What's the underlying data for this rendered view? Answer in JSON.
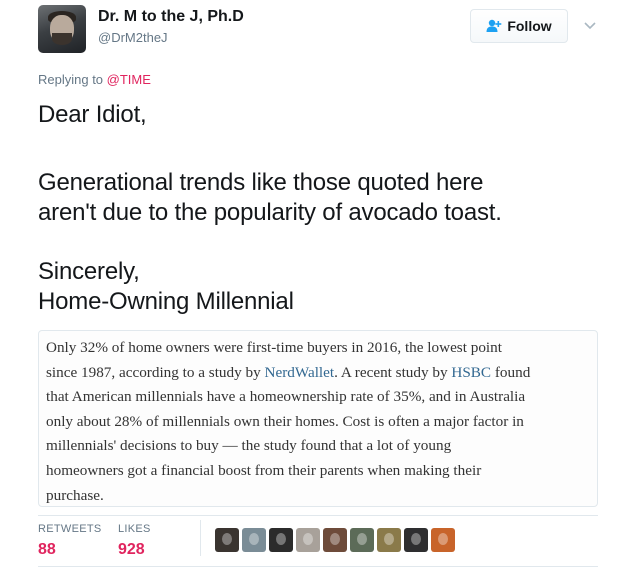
{
  "author": {
    "name": "Dr. M to the J, Ph.D",
    "handle": "@DrM2theJ",
    "avatar_icon": "user-avatar"
  },
  "follow_button": {
    "label": "Follow",
    "icon": "add-user-icon"
  },
  "menu": {
    "icon": "chevron-down-icon"
  },
  "reply": {
    "prefix": "Replying to ",
    "target": "@TIME",
    "target_color": "#e0245e"
  },
  "tweet": {
    "lines": [
      "Dear Idiot,",
      "Generational trends like those quoted here",
      "aren't due to the popularity of avocado toast.",
      "Sincerely,",
      "Home-Owning Millennial"
    ]
  },
  "quote": {
    "line1": "Only 32% of home owners were first-time buyers in 2016, the lowest point",
    "line2_a": "since 1987, according to a study by ",
    "line2_link": "NerdWallet",
    "line2_b": ". A recent study by ",
    "line2_link2": "HSBC",
    "line2_c": " found",
    "line3": "that American millennials have a homeownership rate of 35%, and in Australia",
    "line4": "only about 28% of millennials own their homes. Cost is often a major factor in",
    "line5": "millennials' decisions to buy — the study found that a lot of young",
    "line6": "homeowners got a financial boost from their parents when making their",
    "line7": "purchase.",
    "link_color": "#326891"
  },
  "stats": {
    "retweets_label": "RETWEETS",
    "retweets_value": "88",
    "likes_label": "LIKES",
    "likes_value": "928",
    "value_color": "#e0245e"
  },
  "likers": [
    "#3a3430",
    "#7a8c96",
    "#2b2b2b",
    "#a8a19a",
    "#6e4b3a",
    "#5c6b58",
    "#8a7a4a",
    "#2e2e30",
    "#c8642a"
  ]
}
